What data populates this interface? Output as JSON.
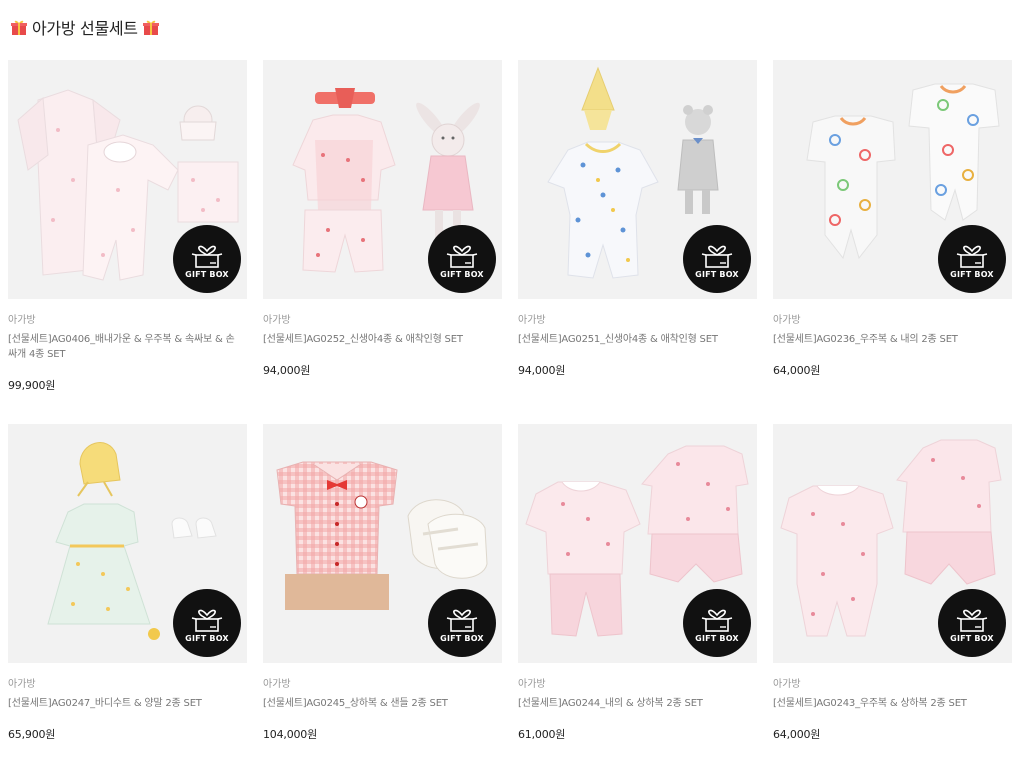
{
  "section": {
    "title": "아가방 선물세트"
  },
  "badge_label": "GIFT BOX",
  "products": [
    {
      "brand": "아가방",
      "name": "[선물세트]AG0406_배내가운 & 우주복 & 속싸보 & 손싸개 4종 SET",
      "price": "99,900원",
      "image": "white-pink-print-set-icon"
    },
    {
      "brand": "아가방",
      "name": "[선물세트]AG0252_신생아4종 & 애착인형 SET",
      "price": "94,000원",
      "image": "coral-floral-set-bunny-icon"
    },
    {
      "brand": "아가방",
      "name": "[선물세트]AG0251_신생아4종 & 애착인형 SET",
      "price": "94,000원",
      "image": "blue-print-set-bear-icon"
    },
    {
      "brand": "아가방",
      "name": "[선물세트]AG0236_우주복 & 내의 2종 SET",
      "price": "64,000원",
      "image": "colorful-print-rompers-icon"
    },
    {
      "brand": "아가방",
      "name": "[선물세트]AG0247_바디수트 & 양말 2종 SET",
      "price": "65,900원",
      "image": "mint-dress-bonnet-icon"
    },
    {
      "brand": "아가방",
      "name": "[선물세트]AG0245_상하복 & 샌들 2종 SET",
      "price": "104,000원",
      "image": "gingham-shirt-sandals-icon"
    },
    {
      "brand": "아가방",
      "name": "[선물세트]AG0244_내의 & 상하복 2종 SET",
      "price": "61,000원",
      "image": "pink-floral-set-icon"
    },
    {
      "brand": "아가방",
      "name": "[선물세트]AG0243_우주복 & 상하복 2종 SET",
      "price": "64,000원",
      "image": "pink-floral-romper-set-icon"
    }
  ],
  "colors": {
    "thumb_bg": "#f2f2f2",
    "badge_bg": "#111111",
    "brand_text": "#999999",
    "name_text": "#777777",
    "price_text": "#222222"
  }
}
